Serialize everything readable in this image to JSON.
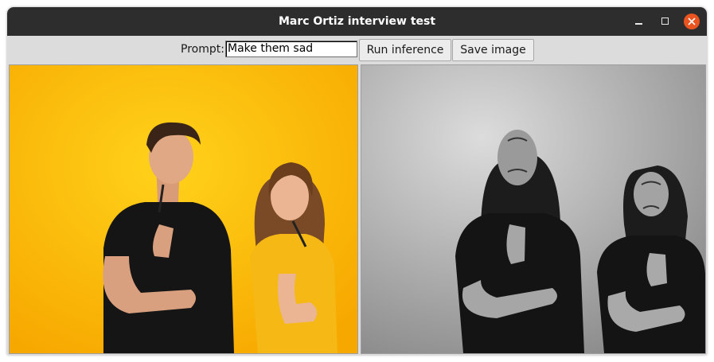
{
  "window": {
    "title": "Marc Ortiz interview test"
  },
  "toolbar": {
    "prompt_label": "Prompt:",
    "prompt_value": "Make them sad",
    "run_label": "Run inference",
    "save_label": "Save image"
  },
  "images": {
    "input": {
      "description_icon": "input-photo-image",
      "background": "#ffc107"
    },
    "output": {
      "description_icon": "output-photo-image",
      "background": "#b8b8b8"
    }
  },
  "colors": {
    "titlebar": "#2d2d2d",
    "close": "#e95420",
    "toolbar": "#dcdcdc"
  }
}
